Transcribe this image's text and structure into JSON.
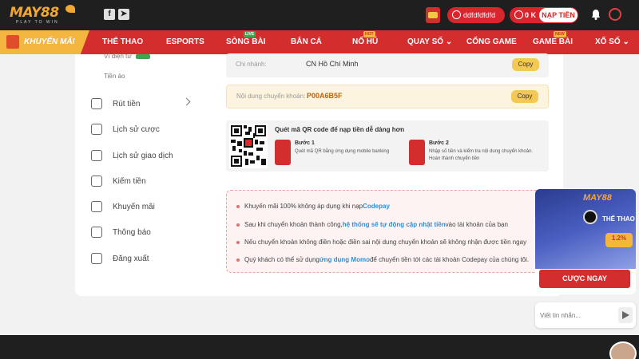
{
  "header": {
    "logo_text": "MAY88",
    "logo_tagline": "PLAY TO WIN",
    "username": "ddfdfdfdfd",
    "balance": "0 K",
    "deposit_label": "NẠP TIỀN",
    "gift_badge": "8 GIỜ"
  },
  "nav": {
    "promo_label": "KHUYẾN MÃI",
    "items": [
      {
        "label": "THỂ THAO"
      },
      {
        "label": "ESPORTS"
      },
      {
        "label": "SÒNG BÀI",
        "badge": "LIVE"
      },
      {
        "label": "BẮN CÁ"
      },
      {
        "label": "NỔ HŨ",
        "badge": "HOT"
      },
      {
        "label": "QUAY SỐ"
      },
      {
        "label": "CỔNG GAME"
      },
      {
        "label": "GAME BÀI",
        "badge": "NEW"
      },
      {
        "label": "XỔ SỐ"
      }
    ]
  },
  "sidebar": {
    "sub_items": [
      "Ví điện tử",
      "Tiền ảo"
    ],
    "items": [
      {
        "label": "Rút tiền"
      },
      {
        "label": "Lịch sử cược"
      },
      {
        "label": "Lịch sử giao dịch"
      },
      {
        "label": "Kiếm tiền"
      },
      {
        "label": "Khuyến mãi"
      },
      {
        "label": "Thông báo"
      },
      {
        "label": "Đăng xuất"
      }
    ]
  },
  "transfer": {
    "branch_label": "Chi nhánh:",
    "branch_value": "CN Hồ Chí Minh",
    "content_label": "Nội dung chuyển khoản:",
    "content_value": "P00A6B5F",
    "copy_label": "Copy"
  },
  "qr": {
    "title": "Quét mã QR code để nạp tiền dễ dàng hơn",
    "steps": [
      {
        "title": "Bước 1",
        "desc": "Quét mã QR bằng ứng dụng mobile banking"
      },
      {
        "title": "Bước 2",
        "desc": "Nhập số tiền và kiểm tra nội dung chuyển khoản. Hoàn thành chuyển tiền"
      }
    ]
  },
  "notes": [
    {
      "pre": "Khuyến mãi 100% không áp dụng khi nạp ",
      "hl": "Codepay",
      "post": ""
    },
    {
      "pre": "Sau khi chuyển khoản thành công, ",
      "hl": "hệ thống sẽ tự động cập nhật tiền",
      "post": " vào tài khoản của bạn"
    },
    {
      "pre": "Nếu chuyển khoản không điền hoặc điền sai nội dung chuyển khoản sẽ không nhận được tiền ngay",
      "hl": "",
      "post": ""
    },
    {
      "pre": "Quý khách có thể sử dụng ",
      "hl": "ứng dụng Momo",
      "post": " để chuyển tiền tới các tài khoản Codepay của chúng tôi."
    }
  ],
  "float_promo": {
    "logo": "MAY88",
    "sport": "THỂ THAO",
    "rate": "1.2%",
    "cta": "CƯỢC NGAY"
  },
  "chat": {
    "placeholder": "Viết tin nhắn..."
  }
}
